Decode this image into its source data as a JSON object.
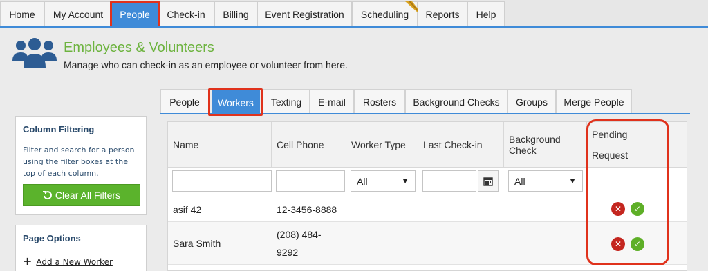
{
  "topnav": {
    "tabs": [
      {
        "label": "Home",
        "active": false
      },
      {
        "label": "My Account",
        "active": false
      },
      {
        "label": "People",
        "active": true
      },
      {
        "label": "Check-in",
        "active": false
      },
      {
        "label": "Billing",
        "active": false
      },
      {
        "label": "Event Registration",
        "active": false
      },
      {
        "label": "Scheduling",
        "active": false
      },
      {
        "label": "Reports",
        "active": false
      },
      {
        "label": "Help",
        "active": false
      }
    ]
  },
  "header": {
    "icon": "people-group-icon",
    "title": "Employees & Volunteers",
    "subtitle": "Manage who can check-in as an employee or volunteer from here."
  },
  "subtabs": [
    {
      "label": "People",
      "active": false
    },
    {
      "label": "Workers",
      "active": true
    },
    {
      "label": "Texting",
      "active": false
    },
    {
      "label": "E-mail",
      "active": false
    },
    {
      "label": "Rosters",
      "active": false
    },
    {
      "label": "Background Checks",
      "active": false
    },
    {
      "label": "Groups",
      "active": false
    },
    {
      "label": "Merge People",
      "active": false
    }
  ],
  "sidebar": {
    "column_filtering": {
      "title": "Column Filtering",
      "description": "Filter and search for a person using the filter boxes at the top of each column.",
      "clear_button": "Clear All Filters"
    },
    "page_options": {
      "title": "Page Options",
      "add_link": "Add a New Worker"
    }
  },
  "table": {
    "columns": {
      "name": "Name",
      "cell_phone": "Cell Phone",
      "worker_type": "Worker Type",
      "last_checkin": "Last Check-in",
      "background_check": "Background Check",
      "pending_request_line1": "Pending",
      "pending_request_line2": "Request"
    },
    "filters": {
      "worker_type": "All",
      "background_check": "All"
    },
    "rows": [
      {
        "name": "asif 42",
        "phone_line1": "12-3456-8888",
        "phone_line2": ""
      },
      {
        "name": "Sara Smith",
        "phone_line1": "(208) 484-",
        "phone_line2": "9292"
      }
    ]
  },
  "colors": {
    "brand_blue": "#3f8bd8",
    "title_green": "#6db33f",
    "highlight_red": "#e0321c",
    "button_green": "#5bb32c"
  }
}
